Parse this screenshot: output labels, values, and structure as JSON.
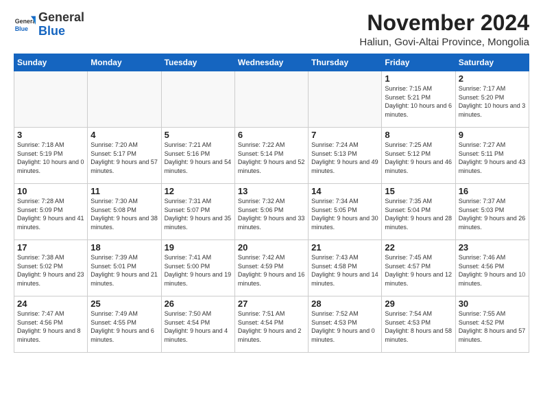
{
  "logo": {
    "general": "General",
    "blue": "Blue"
  },
  "title": "November 2024",
  "subtitle": "Haliun, Govi-Altai Province, Mongolia",
  "days_of_week": [
    "Sunday",
    "Monday",
    "Tuesday",
    "Wednesday",
    "Thursday",
    "Friday",
    "Saturday"
  ],
  "weeks": [
    [
      {
        "day": "",
        "info": ""
      },
      {
        "day": "",
        "info": ""
      },
      {
        "day": "",
        "info": ""
      },
      {
        "day": "",
        "info": ""
      },
      {
        "day": "",
        "info": ""
      },
      {
        "day": "1",
        "info": "Sunrise: 7:15 AM\nSunset: 5:21 PM\nDaylight: 10 hours and 6 minutes."
      },
      {
        "day": "2",
        "info": "Sunrise: 7:17 AM\nSunset: 5:20 PM\nDaylight: 10 hours and 3 minutes."
      }
    ],
    [
      {
        "day": "3",
        "info": "Sunrise: 7:18 AM\nSunset: 5:19 PM\nDaylight: 10 hours and 0 minutes."
      },
      {
        "day": "4",
        "info": "Sunrise: 7:20 AM\nSunset: 5:17 PM\nDaylight: 9 hours and 57 minutes."
      },
      {
        "day": "5",
        "info": "Sunrise: 7:21 AM\nSunset: 5:16 PM\nDaylight: 9 hours and 54 minutes."
      },
      {
        "day": "6",
        "info": "Sunrise: 7:22 AM\nSunset: 5:14 PM\nDaylight: 9 hours and 52 minutes."
      },
      {
        "day": "7",
        "info": "Sunrise: 7:24 AM\nSunset: 5:13 PM\nDaylight: 9 hours and 49 minutes."
      },
      {
        "day": "8",
        "info": "Sunrise: 7:25 AM\nSunset: 5:12 PM\nDaylight: 9 hours and 46 minutes."
      },
      {
        "day": "9",
        "info": "Sunrise: 7:27 AM\nSunset: 5:11 PM\nDaylight: 9 hours and 43 minutes."
      }
    ],
    [
      {
        "day": "10",
        "info": "Sunrise: 7:28 AM\nSunset: 5:09 PM\nDaylight: 9 hours and 41 minutes."
      },
      {
        "day": "11",
        "info": "Sunrise: 7:30 AM\nSunset: 5:08 PM\nDaylight: 9 hours and 38 minutes."
      },
      {
        "day": "12",
        "info": "Sunrise: 7:31 AM\nSunset: 5:07 PM\nDaylight: 9 hours and 35 minutes."
      },
      {
        "day": "13",
        "info": "Sunrise: 7:32 AM\nSunset: 5:06 PM\nDaylight: 9 hours and 33 minutes."
      },
      {
        "day": "14",
        "info": "Sunrise: 7:34 AM\nSunset: 5:05 PM\nDaylight: 9 hours and 30 minutes."
      },
      {
        "day": "15",
        "info": "Sunrise: 7:35 AM\nSunset: 5:04 PM\nDaylight: 9 hours and 28 minutes."
      },
      {
        "day": "16",
        "info": "Sunrise: 7:37 AM\nSunset: 5:03 PM\nDaylight: 9 hours and 26 minutes."
      }
    ],
    [
      {
        "day": "17",
        "info": "Sunrise: 7:38 AM\nSunset: 5:02 PM\nDaylight: 9 hours and 23 minutes."
      },
      {
        "day": "18",
        "info": "Sunrise: 7:39 AM\nSunset: 5:01 PM\nDaylight: 9 hours and 21 minutes."
      },
      {
        "day": "19",
        "info": "Sunrise: 7:41 AM\nSunset: 5:00 PM\nDaylight: 9 hours and 19 minutes."
      },
      {
        "day": "20",
        "info": "Sunrise: 7:42 AM\nSunset: 4:59 PM\nDaylight: 9 hours and 16 minutes."
      },
      {
        "day": "21",
        "info": "Sunrise: 7:43 AM\nSunset: 4:58 PM\nDaylight: 9 hours and 14 minutes."
      },
      {
        "day": "22",
        "info": "Sunrise: 7:45 AM\nSunset: 4:57 PM\nDaylight: 9 hours and 12 minutes."
      },
      {
        "day": "23",
        "info": "Sunrise: 7:46 AM\nSunset: 4:56 PM\nDaylight: 9 hours and 10 minutes."
      }
    ],
    [
      {
        "day": "24",
        "info": "Sunrise: 7:47 AM\nSunset: 4:56 PM\nDaylight: 9 hours and 8 minutes."
      },
      {
        "day": "25",
        "info": "Sunrise: 7:49 AM\nSunset: 4:55 PM\nDaylight: 9 hours and 6 minutes."
      },
      {
        "day": "26",
        "info": "Sunrise: 7:50 AM\nSunset: 4:54 PM\nDaylight: 9 hours and 4 minutes."
      },
      {
        "day": "27",
        "info": "Sunrise: 7:51 AM\nSunset: 4:54 PM\nDaylight: 9 hours and 2 minutes."
      },
      {
        "day": "28",
        "info": "Sunrise: 7:52 AM\nSunset: 4:53 PM\nDaylight: 9 hours and 0 minutes."
      },
      {
        "day": "29",
        "info": "Sunrise: 7:54 AM\nSunset: 4:53 PM\nDaylight: 8 hours and 58 minutes."
      },
      {
        "day": "30",
        "info": "Sunrise: 7:55 AM\nSunset: 4:52 PM\nDaylight: 8 hours and 57 minutes."
      }
    ]
  ]
}
